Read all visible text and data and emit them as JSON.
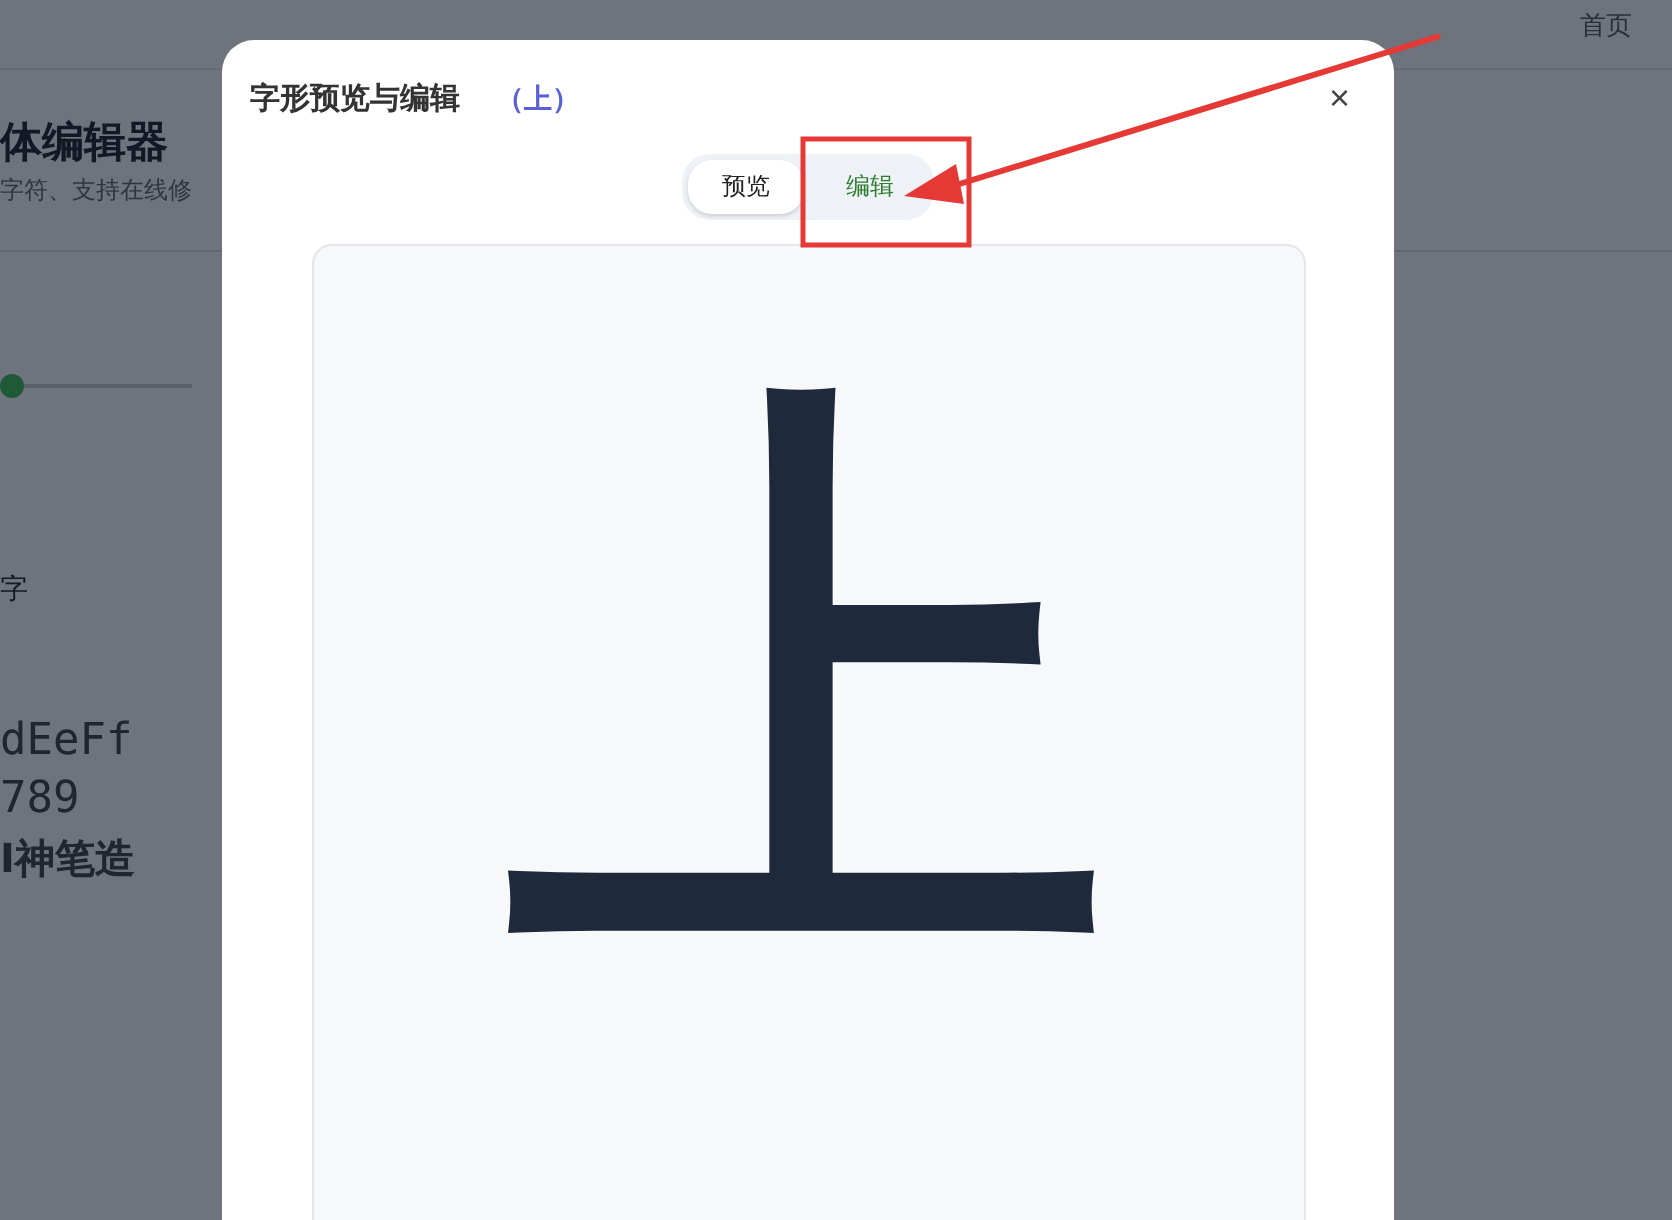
{
  "background": {
    "nav": [
      "首页"
    ],
    "title": "体编辑器",
    "subtitle": "字符、支持在线修",
    "slider": {
      "level": 0.0
    },
    "sample_label": "字",
    "samples": [
      "dEeFf",
      "789",
      "I神笔造"
    ]
  },
  "dialog": {
    "title": "字形预览与编辑",
    "glyph_label": "（上）",
    "close": "×",
    "tabs": [
      {
        "label": "预览",
        "selected": true
      },
      {
        "label": "编辑",
        "selected": false
      }
    ],
    "glyph": "上"
  }
}
